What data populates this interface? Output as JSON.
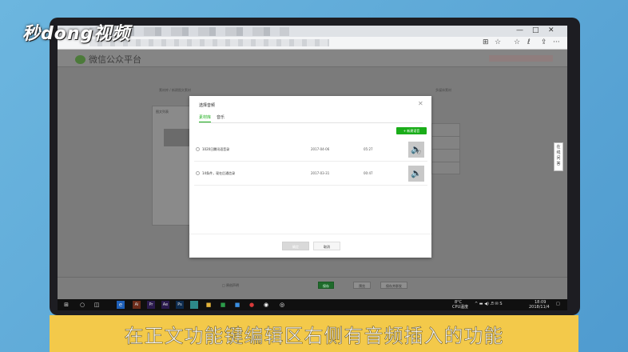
{
  "watermark": "秒dong视频",
  "browser": {
    "window_controls": [
      "—",
      "□",
      "✕"
    ],
    "address_icons": [
      "⊞",
      "☆",
      "☆",
      "ℓ",
      "⇪",
      "···"
    ]
  },
  "platform": {
    "logo_text": "微信公众平台",
    "breadcrumb": "素材库 / 新建图文素材",
    "right_link": "多媒体素材",
    "bg_panel_title": "图文列表",
    "side_float": [
      "在",
      "线",
      "问",
      "答"
    ]
  },
  "modal": {
    "title": "选择音频",
    "close_icon": "✕",
    "tabs": [
      "素材库",
      "音乐"
    ],
    "new_button": "+ 新建语音",
    "rows": [
      {
        "name": "1020日腾讯语音录",
        "date": "2017-04-06",
        "duration": "05:27"
      },
      {
        "name": "14条件，现在后通信录",
        "date": "2017-03-31",
        "duration": "00:47"
      }
    ],
    "ok": "确定",
    "cancel": "取消"
  },
  "bottom_bar": {
    "checkbox_label": "□ 原创声明",
    "save": "保存",
    "preview": "预览",
    "send": "保存并群发"
  },
  "taskbar": {
    "weather": "8°C",
    "cpu": "CPU温度",
    "time": "18:09",
    "date": "2018/11/4"
  },
  "caption": "在正文功能键编辑区右侧有音频插入的功能"
}
